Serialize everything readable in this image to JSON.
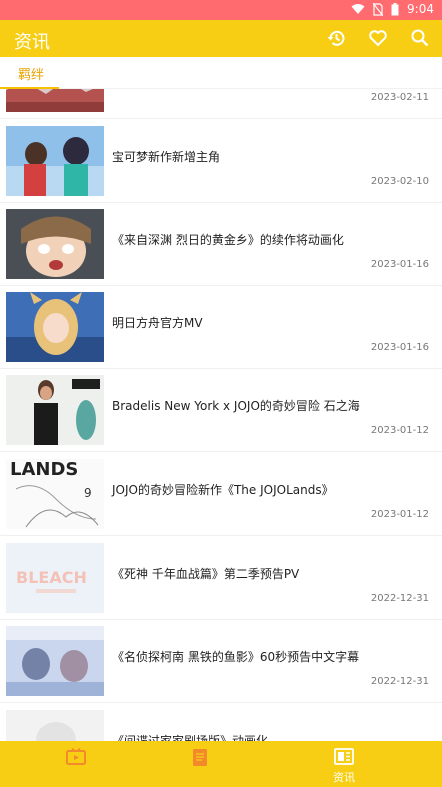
{
  "status_bar": {
    "time": "9:04"
  },
  "app_bar": {
    "title": "资讯"
  },
  "tabs": [
    {
      "label": "羁绊"
    }
  ],
  "news": [
    {
      "title": "",
      "date": "2023-02-11"
    },
    {
      "title": "宝可梦新作新增主角",
      "date": "2023-02-10"
    },
    {
      "title": "《来自深渊 烈日的黄金乡》的续作将动画化",
      "date": "2023-01-16"
    },
    {
      "title": "明日方舟官方MV",
      "date": "2023-01-16"
    },
    {
      "title": "Bradelis New York x JOJO的奇妙冒险 石之海",
      "date": "2023-01-12"
    },
    {
      "title": "JOJO的奇妙冒险新作《The JOJOLands》",
      "date": "2023-01-12"
    },
    {
      "title": "《死神 千年血战篇》第二季预告PV",
      "date": "2022-12-31"
    },
    {
      "title": "《名侦探柯南 黑铁的鱼影》60秒预告中文字幕",
      "date": "2022-12-31"
    },
    {
      "title": "《间谍过家家剧场版》动画化",
      "date": ""
    }
  ],
  "bottom_nav": [
    {
      "label": "",
      "icon": "tv-icon"
    },
    {
      "label": "",
      "icon": "book-icon"
    },
    {
      "label": "资讯",
      "icon": "news-icon"
    }
  ],
  "colors": {
    "accent": "#f7ce13",
    "status_bar": "#ff6b6e",
    "tab_active": "#e8a300"
  }
}
